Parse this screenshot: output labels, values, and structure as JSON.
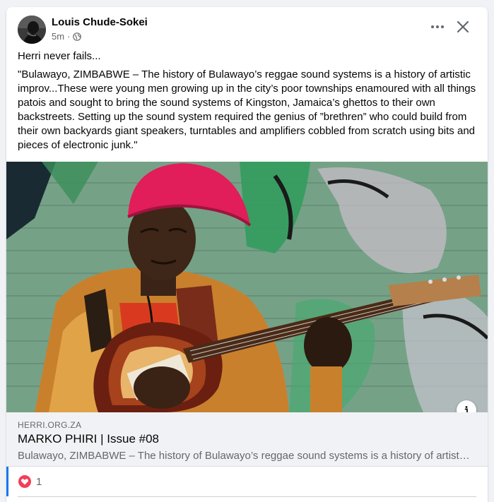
{
  "post": {
    "author": "Louis Chude-Sokei",
    "time": "5m",
    "separator": "·",
    "privacy_icon": "globe-icon",
    "text": "Herri never fails...",
    "quote": "\"Bulawayo, ZIMBABWE – The history of Bulawayo’s reggae sound systems is a history of artistic improv...These were young men growing up in the city’s poor townships enamoured with all things patois and sought to bring the sound systems of Kingston, Jamaica’s ghettos to their own backstreets. Setting up the sound system required the genius of ”brethren” who could build from their own backyards giant speakers, turntables and amplifiers cobbled from scratch using bits and pieces of electronic junk.\""
  },
  "header_actions": {
    "more_icon": "more-dots-icon",
    "close_icon": "close-icon"
  },
  "link_preview": {
    "domain": "HERRI.ORG.ZA",
    "title": "MARKO PHIRI | Issue #08",
    "description": "Bulawayo, ZIMBABWE – The history of Bulawayo’s reggae sound systems is a history of artistic improv...These were young men growing up in the city’s poor townships",
    "info_icon": "info-icon",
    "image_subject": "man-with-red-hat-playing-guitar-photo"
  },
  "reactions": {
    "icon": "love-reaction-icon",
    "count": "1"
  },
  "colors": {
    "love": "#f33e58",
    "accent": "#1877f2",
    "secondary_text": "#65676b"
  }
}
